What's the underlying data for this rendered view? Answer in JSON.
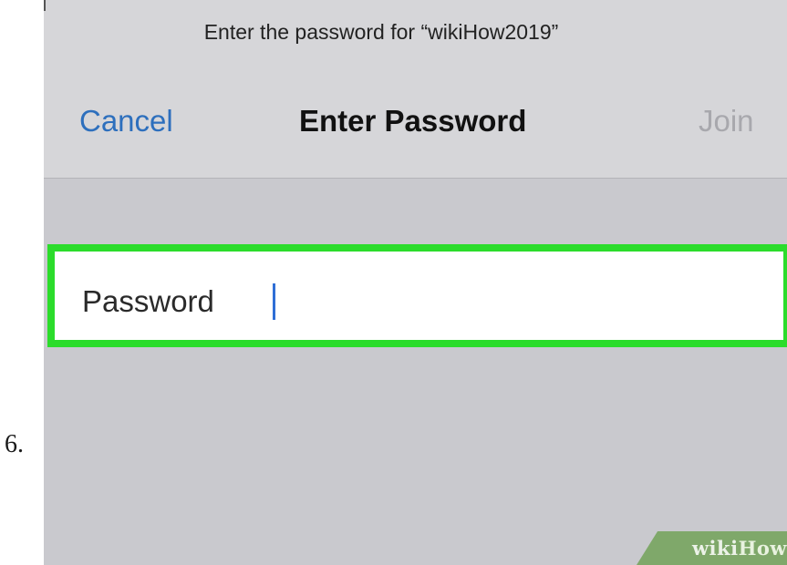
{
  "step": {
    "number": "6."
  },
  "dialog": {
    "prompt": "Enter the password for “wikiHow2019”",
    "cancel_label": "Cancel",
    "title": "Enter Password",
    "join_label": "Join",
    "join_enabled": false
  },
  "password_field": {
    "label": "Password",
    "value": "",
    "highlight_color": "#2bdc2b",
    "caret_color": "#2f6fd6"
  },
  "watermark": {
    "part1": "wiki",
    "part2": "How"
  },
  "colors": {
    "link_blue": "#2d6fbd",
    "disabled_gray": "#a8a8ad",
    "background_gray": "#c9c9ce"
  }
}
